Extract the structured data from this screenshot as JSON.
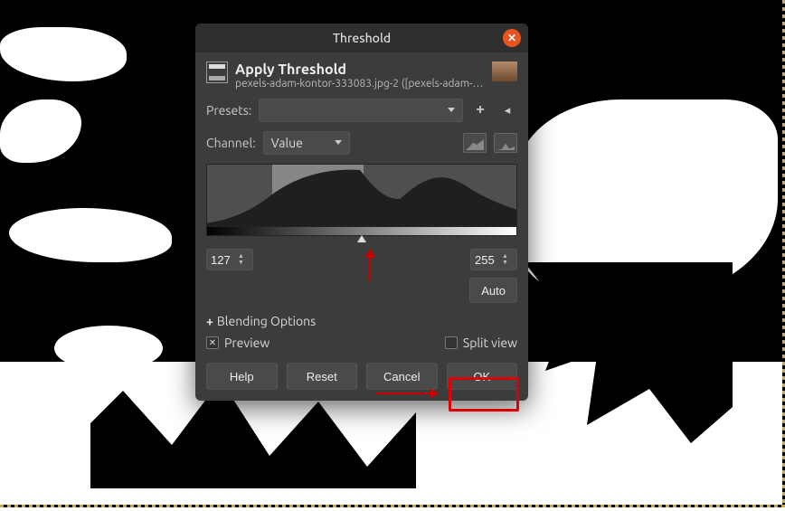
{
  "dialog": {
    "title": "Threshold",
    "header_title": "Apply Threshold",
    "header_sub": "pexels-adam-kontor-333083.jpg-2 ([pexels-adam-k…",
    "presets_label": "Presets:",
    "preset_value": "",
    "channel_label": "Channel:",
    "channel_value": "Value",
    "low": "127",
    "high": "255",
    "auto": "Auto",
    "blending": "Blending Options",
    "preview_label": "Preview",
    "splitview_label": "Split view",
    "help": "Help",
    "reset": "Reset",
    "cancel": "Cancel",
    "ok": "OK"
  },
  "icons": {
    "close": "✕"
  }
}
